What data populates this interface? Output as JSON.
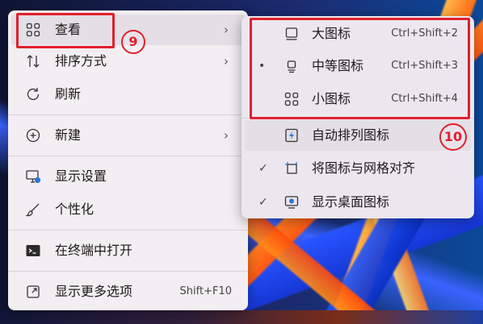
{
  "main_menu": {
    "items": [
      {
        "label": "查看",
        "icon": "grid-icon"
      },
      {
        "label": "排序方式",
        "icon": "sort-icon"
      },
      {
        "label": "刷新",
        "icon": "refresh-icon"
      },
      {
        "label": "新建",
        "icon": "plus-circle-icon"
      },
      {
        "label": "显示设置",
        "icon": "display-settings-icon"
      },
      {
        "label": "个性化",
        "icon": "brush-icon"
      },
      {
        "label": "在终端中打开",
        "icon": "terminal-icon"
      },
      {
        "label": "显示更多选项",
        "icon": "open-external-icon",
        "shortcut": "Shift+F10"
      }
    ]
  },
  "view_submenu": {
    "items": [
      {
        "label": "大图标",
        "shortcut": "Ctrl+Shift+2"
      },
      {
        "label": "中等图标",
        "shortcut": "Ctrl+Shift+3"
      },
      {
        "label": "小图标",
        "shortcut": "Ctrl+Shift+4"
      },
      {
        "label": "自动排列图标"
      },
      {
        "label": "将图标与网格对齐"
      },
      {
        "label": "显示桌面图标"
      }
    ]
  },
  "annotations": {
    "badge_view": "9",
    "badge_auto_arrange": "10"
  },
  "colors": {
    "annotation_red": "#e0202d",
    "menu_bg": "#f3eef1"
  }
}
